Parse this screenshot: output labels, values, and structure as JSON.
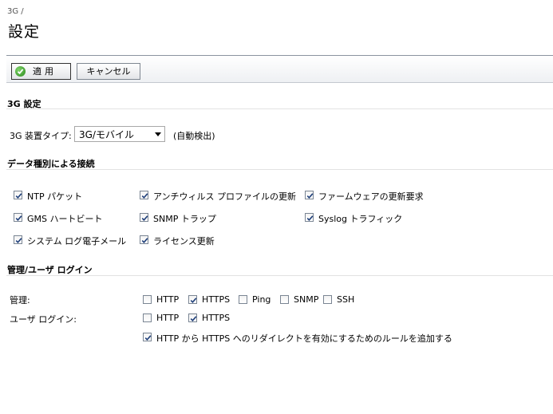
{
  "breadcrumb": "3G /",
  "page_title": "設定",
  "toolbar": {
    "apply_label": "適用",
    "cancel_label": "キャンセル"
  },
  "section_3g": {
    "title": "3G 設定",
    "device_type_label": "3G 装置タイプ:",
    "device_type_value": "3G/モバイル",
    "auto_detect": "(自動検出)"
  },
  "section_data": {
    "title": "データ種別による接続",
    "items": [
      {
        "label": "NTP パケット",
        "checked": true
      },
      {
        "label": "アンチウィルス プロファイルの更新",
        "checked": true
      },
      {
        "label": "ファームウェアの更新要求",
        "checked": true
      },
      {
        "label": "GMS ハートビート",
        "checked": true
      },
      {
        "label": "SNMP トラップ",
        "checked": true
      },
      {
        "label": "Syslog トラフィック",
        "checked": true
      },
      {
        "label": "システム ログ電子メール",
        "checked": true
      },
      {
        "label": "ライセンス更新",
        "checked": true
      }
    ]
  },
  "section_mgmt": {
    "title": "管理/ユーザ ログイン",
    "mgmt_label": "管理:",
    "user_label": "ユーザ ログイン:",
    "mgmt_items": [
      {
        "label": "HTTP",
        "checked": false
      },
      {
        "label": "HTTPS",
        "checked": true
      },
      {
        "label": "Ping",
        "checked": false
      },
      {
        "label": "SNMP",
        "checked": false
      },
      {
        "label": "SSH",
        "checked": false
      }
    ],
    "user_items": [
      {
        "label": "HTTP",
        "checked": false
      },
      {
        "label": "HTTPS",
        "checked": true
      }
    ],
    "redirect": {
      "label": "HTTP から HTTPS へのリダイレクトを有効にするためのルールを追加する",
      "checked": true
    }
  }
}
